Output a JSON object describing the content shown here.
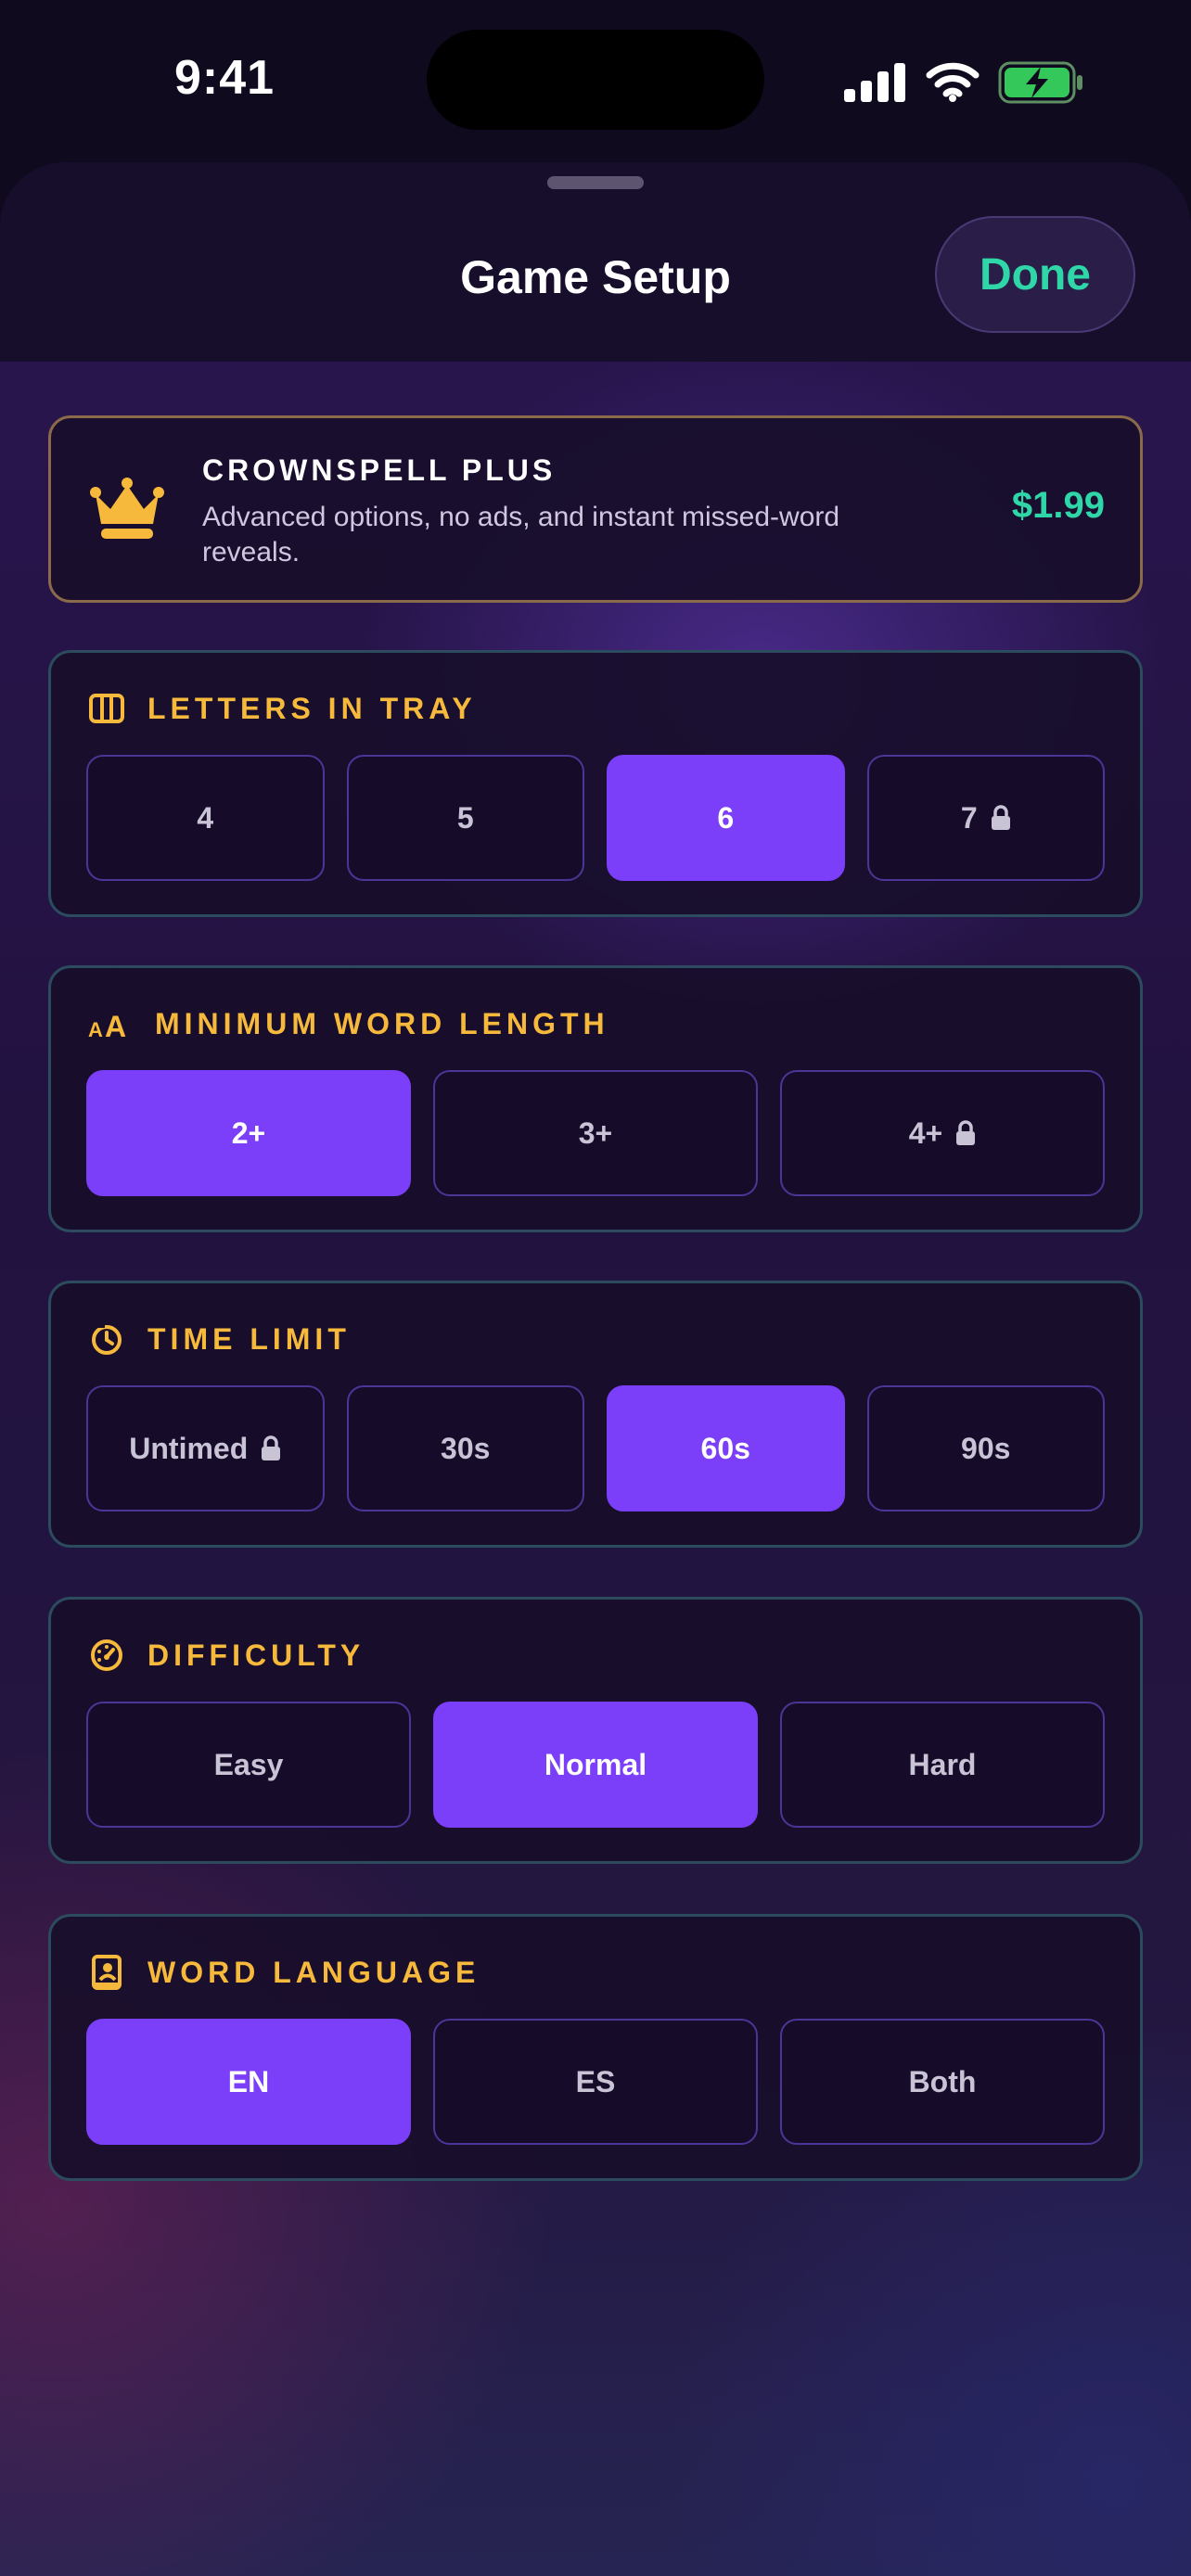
{
  "status_bar": {
    "time": "9:41",
    "icons": [
      "signal-icon",
      "wifi-icon",
      "battery-charging-icon"
    ]
  },
  "header": {
    "title": "Game Setup",
    "done_label": "Done"
  },
  "promo": {
    "icon": "crown-icon",
    "title": "CROWNSPELL PLUS",
    "subtitle": "Advanced options, no ads, and instant missed-word reveals.",
    "price": "$1.99"
  },
  "sections": {
    "letters": {
      "icon": "tray-icon",
      "title": "LETTERS IN TRAY",
      "options": [
        {
          "label": "4",
          "selected": false,
          "locked": false
        },
        {
          "label": "5",
          "selected": false,
          "locked": false
        },
        {
          "label": "6",
          "selected": true,
          "locked": false
        },
        {
          "label": "7",
          "selected": false,
          "locked": true
        }
      ]
    },
    "min_length": {
      "icon": "text-size-icon",
      "title": "MINIMUM WORD LENGTH",
      "options": [
        {
          "label": "2+",
          "selected": true,
          "locked": false
        },
        {
          "label": "3+",
          "selected": false,
          "locked": false
        },
        {
          "label": "4+",
          "selected": false,
          "locked": true
        }
      ]
    },
    "time_limit": {
      "icon": "timer-icon",
      "title": "TIME LIMIT",
      "options": [
        {
          "label": "Untimed",
          "selected": false,
          "locked": true
        },
        {
          "label": "30s",
          "selected": false,
          "locked": false
        },
        {
          "label": "60s",
          "selected": true,
          "locked": false
        },
        {
          "label": "90s",
          "selected": false,
          "locked": false
        }
      ]
    },
    "difficulty": {
      "icon": "gauge-icon",
      "title": "DIFFICULTY",
      "options": [
        {
          "label": "Easy",
          "selected": false,
          "locked": false
        },
        {
          "label": "Normal",
          "selected": true,
          "locked": false
        },
        {
          "label": "Hard",
          "selected": false,
          "locked": false
        }
      ]
    },
    "language": {
      "icon": "dictionary-icon",
      "title": "WORD LANGUAGE",
      "options": [
        {
          "label": "EN",
          "selected": true,
          "locked": false
        },
        {
          "label": "ES",
          "selected": false,
          "locked": false
        },
        {
          "label": "Both",
          "selected": false,
          "locked": false
        }
      ]
    }
  },
  "colors": {
    "accent": "#7b3ff9",
    "gold": "#f6b93b",
    "price_green": "#2fd6a8",
    "battery_green": "#34c759"
  }
}
